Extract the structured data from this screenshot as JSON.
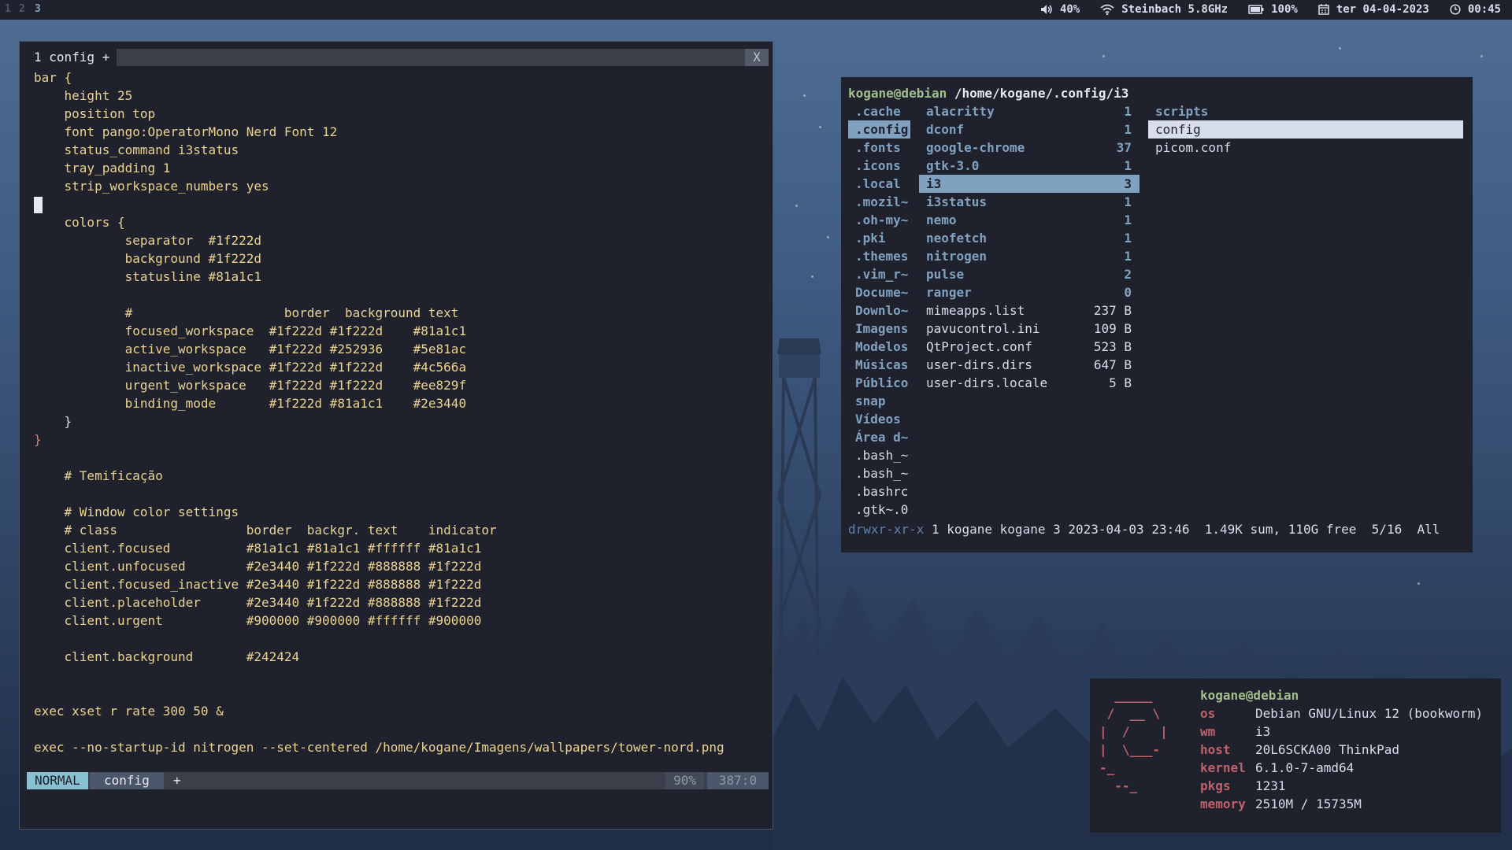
{
  "topbar": {
    "workspaces": [
      "1",
      "2",
      "3"
    ],
    "volume": "40%",
    "wifi": "Steinbach 5.8GHz",
    "battery": "100%",
    "date": "ter 04-04-2023",
    "time": "00:45"
  },
  "vim": {
    "tab_label": "1 config +",
    "close_label": "X",
    "lines": [
      "bar {",
      "height 25",
      "position top",
      "font pango:OperatorMono Nerd Font 12",
      "status_command i3status",
      "tray_padding 1",
      "strip_workspace_numbers yes",
      "",
      "colors {",
      "separator  #1f222d",
      "background #1f222d",
      "statusline #81a1c1",
      "",
      "#                    border  background text",
      "focused_workspace  #1f222d #1f222d    #81a1c1",
      "active_workspace   #1f222d #252936    #5e81ac",
      "inactive_workspace #1f222d #1f222d    #4c566a",
      "urgent_workspace   #1f222d #1f222d    #ee829f",
      "binding_mode       #1f222d #81a1c1    #2e3440",
      "}",
      "}",
      "",
      "# Temificação",
      "",
      "# Window color settings",
      "# class                 border  backgr. text    indicator",
      "client.focused          #81a1c1 #81a1c1 #ffffff #81a1c1",
      "client.unfocused        #2e3440 #1f222d #888888 #1f222d",
      "client.focused_inactive #2e3440 #1f222d #888888 #1f222d",
      "client.placeholder      #2e3440 #1f222d #888888 #1f222d",
      "client.urgent           #900000 #900000 #ffffff #900000",
      "",
      "client.background       #242424",
      "",
      "",
      "exec xset r rate 300 50 &",
      "",
      "exec --no-startup-id nitrogen --set-centered /home/kogane/Imagens/wallpapers/tower-nord.png"
    ],
    "statusline": {
      "mode": "NORMAL",
      "filename": "config",
      "modified": "+",
      "percent": "90%",
      "position": "387:0"
    }
  },
  "ranger": {
    "user_host": "kogane@debian",
    "path": "/home/kogane/.config/",
    "current": "i3",
    "parent": [
      ".cache",
      ".config",
      ".fonts",
      ".icons",
      ".local",
      ".mozil~",
      ".oh-my~",
      ".pki",
      ".themes",
      ".vim_r~",
      "Docume~",
      "Downlo~",
      "Imagens",
      "Modelos",
      "Músicas",
      "Público",
      "snap",
      "Vídeos",
      "Área d~",
      ".bash_~",
      ".bash_~",
      ".bashrc",
      ".gtk~.0"
    ],
    "parent_selected": 1,
    "current_dir": [
      {
        "name": "alacritty",
        "size": "1"
      },
      {
        "name": "dconf",
        "size": "1"
      },
      {
        "name": "google-chrome",
        "size": "37"
      },
      {
        "name": "gtk-3.0",
        "size": "1"
      },
      {
        "name": "i3",
        "size": "3"
      },
      {
        "name": "i3status",
        "size": "1"
      },
      {
        "name": "nemo",
        "size": "1"
      },
      {
        "name": "neofetch",
        "size": "1"
      },
      {
        "name": "nitrogen",
        "size": "1"
      },
      {
        "name": "pulse",
        "size": "2"
      },
      {
        "name": "ranger",
        "size": "0"
      },
      {
        "name": "mimeapps.list",
        "size": "237 B"
      },
      {
        "name": "pavucontrol.ini",
        "size": "109 B"
      },
      {
        "name": "QtProject.conf",
        "size": "523 B"
      },
      {
        "name": "user-dirs.dirs",
        "size": "647 B"
      },
      {
        "name": "user-dirs.locale",
        "size": "5 B"
      }
    ],
    "current_selected": 4,
    "preview": [
      "scripts",
      "config",
      "picom.conf"
    ],
    "preview_selected": 1,
    "info": {
      "perms": "drwxr-xr-x",
      "details": "1 kogane kogane 3 2023-04-03 23:46",
      "summary": "1.49K sum, 110G free",
      "position": "5/16",
      "scroll": "All"
    }
  },
  "neofetch": {
    "title": "kogane@debian",
    "rows": [
      {
        "label": "os",
        "value": "Debian GNU/Linux 12 (bookworm)"
      },
      {
        "label": "wm",
        "value": "i3"
      },
      {
        "label": "host",
        "value": "20L6SCKA00 ThinkPad"
      },
      {
        "label": "kernel",
        "value": "6.1.0-7-amd64"
      },
      {
        "label": "pkgs",
        "value": "1231"
      },
      {
        "label": "memory",
        "value": "2510M / 15735M"
      }
    ]
  }
}
